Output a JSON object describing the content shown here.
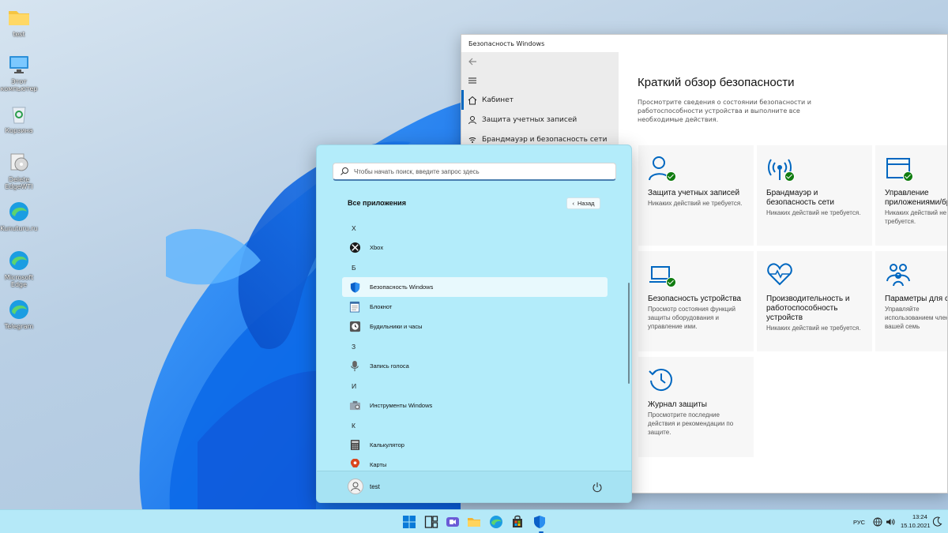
{
  "desktop": {
    "icons": [
      {
        "label": "test",
        "icon": "folder-icon"
      },
      {
        "label": "Этот компьютер",
        "icon": "computer-icon"
      },
      {
        "label": "Корзина",
        "icon": "recycle-bin-icon"
      },
      {
        "label": "Delete EdgeWTI",
        "icon": "disc-icon"
      },
      {
        "label": "Kunuturu.ru",
        "icon": "edge-icon"
      },
      {
        "label": "Microsoft Edge",
        "icon": "edge-icon"
      },
      {
        "label": "Telegram",
        "icon": "edge-icon"
      }
    ]
  },
  "security_window": {
    "title": "Безопасность Windows",
    "nav": {
      "items": [
        {
          "label": "Кабинет",
          "icon": "home-icon"
        },
        {
          "label": "Защита учетных записей",
          "icon": "person-icon"
        },
        {
          "label": "Брандмауэр и безопасность сети",
          "icon": "wifi-icon"
        }
      ]
    },
    "heading": "Краткий обзор безопасности",
    "description": "Просмотрите сведения о состоянии безопасности и работоспособности устройства и выполните все необходимые действия.",
    "tiles": [
      {
        "title": "Защита учетных записей",
        "status": "Никаких действий не требуется.",
        "icon": "account-protection-icon"
      },
      {
        "title": "Брандмауэр и безопасность сети",
        "status": "Никаких действий не требуется.",
        "icon": "firewall-icon"
      },
      {
        "title": "Управление приложениями/бр",
        "status": "Никаких действий не требуется.",
        "icon": "app-browser-control-icon"
      },
      {
        "title": "Безопасность устройства",
        "status": "Просмотр состояния функций защиты оборудования и управление ими.",
        "icon": "device-security-icon"
      },
      {
        "title": "Производительность и работоспособность устройств",
        "status": "Никаких действий не требуется.",
        "icon": "device-health-icon"
      },
      {
        "title": "Параметры для се",
        "status": "Управляйте использованием членами вашей семь",
        "icon": "family-icon"
      },
      {
        "title": "Журнал защиты",
        "status": "Просмотрите последние действия и рекомендации по защите.",
        "icon": "protection-history-icon"
      }
    ]
  },
  "start_menu": {
    "search_placeholder": "Чтобы начать поиск, введите запрос здесь",
    "all_apps_label": "Все приложения",
    "back_label": "Назад",
    "list": [
      {
        "type": "letter",
        "label": "X"
      },
      {
        "type": "app",
        "label": "Xbox",
        "icon": "xbox-icon"
      },
      {
        "type": "letter",
        "label": "Б"
      },
      {
        "type": "app",
        "label": "Безопасность Windows",
        "icon": "shield-icon",
        "active": true
      },
      {
        "type": "app",
        "label": "Блокнот",
        "icon": "notepad-icon"
      },
      {
        "type": "app",
        "label": "Будильники и часы",
        "icon": "alarm-clock-icon"
      },
      {
        "type": "letter",
        "label": "З"
      },
      {
        "type": "app",
        "label": "Запись голоса",
        "icon": "microphone-icon"
      },
      {
        "type": "letter",
        "label": "И"
      },
      {
        "type": "app",
        "label": "Инструменты Windows",
        "icon": "tools-icon"
      },
      {
        "type": "letter",
        "label": "К"
      },
      {
        "type": "app",
        "label": "Калькулятор",
        "icon": "calculator-icon"
      },
      {
        "type": "app",
        "label": "Карты",
        "icon": "maps-icon"
      }
    ],
    "user_name": "test"
  },
  "taskbar": {
    "apps": [
      "start-icon",
      "task-view-icon",
      "chat-icon",
      "file-explorer-icon",
      "edge-icon",
      "store-icon",
      "security-shield-icon"
    ],
    "language": "РУС",
    "time": "13:24",
    "date": "15.10.2021"
  },
  "colors": {
    "accent_blue": "#0067c0",
    "check_green": "#107c10",
    "start_bg": "#b3ecfa",
    "taskbar_bg": "#b5e9f8"
  }
}
